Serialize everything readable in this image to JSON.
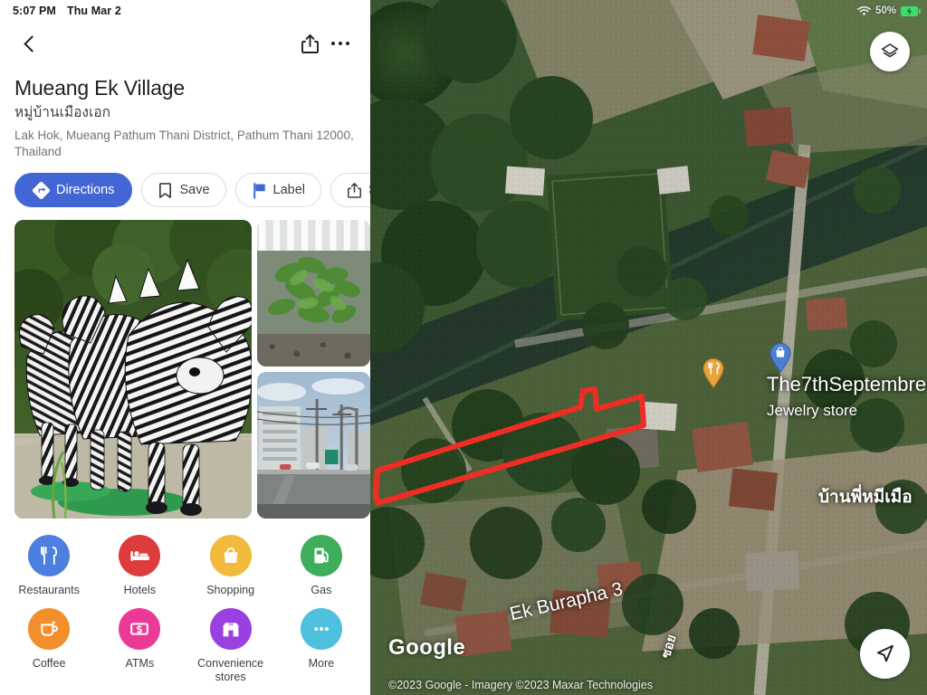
{
  "status_bar": {
    "time": "5:07 PM",
    "date": "Thu Mar 2",
    "battery_percent": "50%",
    "wifi_icon": "wifi-icon",
    "battery_icon": "battery-charging-icon"
  },
  "nav": {
    "back_icon": "back-chevron-icon",
    "share_icon": "share-icon",
    "overflow_icon": "more-options-icon"
  },
  "place": {
    "title": "Mueang Ek Village",
    "title_native": "หมู่บ้านเมืองเอก",
    "address": "Lak Hok, Mueang Pathum Thani District, Pathum Thani 12000, Thailand"
  },
  "actions": [
    {
      "label": "Directions",
      "icon": "directions-icon",
      "primary": true
    },
    {
      "label": "Save",
      "icon": "bookmark-icon",
      "primary": false
    },
    {
      "label": "Label",
      "icon": "flag-icon",
      "primary": false
    },
    {
      "label": "S",
      "icon": "share-icon",
      "primary": false
    }
  ],
  "photos": [
    {
      "name": "zebra-statues-photo",
      "alt": "Row of black and white zebra statues on a paved walkway"
    },
    {
      "name": "green-plants-photo",
      "alt": "Green leafy plants beside a white fence"
    },
    {
      "name": "street-scene-photo",
      "alt": "Street with buildings, power lines and traffic"
    }
  ],
  "categories": [
    {
      "label": "Restaurants",
      "icon": "restaurant-icon",
      "color": "#4d7fe0"
    },
    {
      "label": "Hotels",
      "icon": "hotel-bed-icon",
      "color": "#dc3c3c"
    },
    {
      "label": "Shopping",
      "icon": "shopping-bag-icon",
      "color": "#f1ba3c"
    },
    {
      "label": "Gas",
      "icon": "gas-pump-icon",
      "color": "#3fae5a"
    },
    {
      "label": "Coffee",
      "icon": "coffee-cup-icon",
      "color": "#f28f2c"
    },
    {
      "label": "ATMs",
      "icon": "atm-cash-icon",
      "color": "#ea3a95"
    },
    {
      "label": "Convenience stores",
      "icon": "convenience-store-icon",
      "color": "#9a3fe0"
    },
    {
      "label": "More",
      "icon": "more-dots-icon",
      "color": "#4fc0dd"
    }
  ],
  "map": {
    "layers_icon": "layers-icon",
    "navigate_icon": "navigation-arrow-icon",
    "watermark": "Google",
    "attribution": "©2023 Google - Imagery ©2023 Maxar Technologies",
    "labels": {
      "poi_name": "The7thSeptembre",
      "poi_type": "Jewelry store",
      "thai_place_1": "บ้านพี่หมีเมือ",
      "street": "Ek Burapha 3",
      "thai_place_2": "ซอย"
    },
    "pins": [
      {
        "name": "restaurant-pin",
        "icon": "restaurant-icon",
        "color": "#e8a33d"
      },
      {
        "name": "store-pin",
        "icon": "shopping-bag-icon",
        "color": "#4a7fd4"
      }
    ],
    "highlight_color": "#f02d24"
  },
  "colors": {
    "accent_blue": "#4267d4",
    "text_primary": "#202124",
    "text_secondary": "#70757a",
    "border": "#dadce0"
  }
}
